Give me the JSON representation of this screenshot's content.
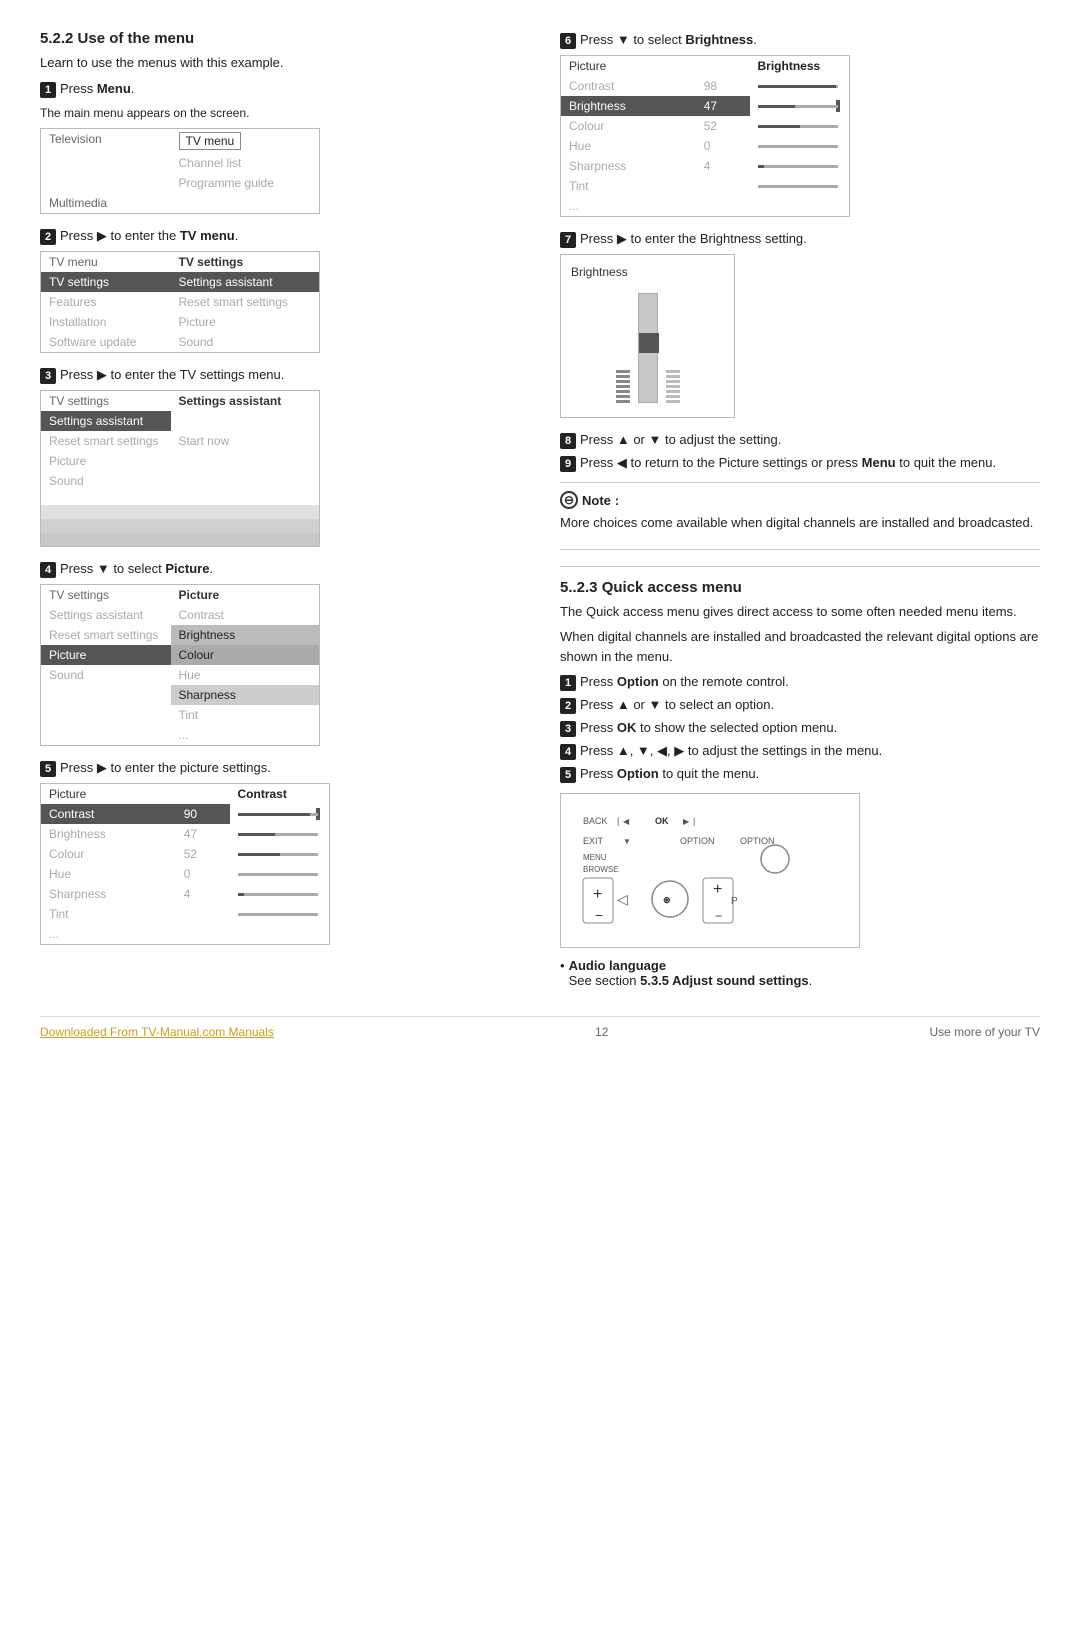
{
  "section": {
    "title": "5.2.2  Use of the menu",
    "intro": "Learn to use the menus with this example."
  },
  "steps_left": [
    {
      "num": "1",
      "text": "Press ",
      "bold": "Menu",
      "suffix": "."
    },
    {
      "num": "2",
      "text": "Press ▶ to enter the ",
      "bold": "TV menu",
      "suffix": "."
    },
    {
      "num": "3",
      "text": "Press ▶ to enter the TV settings menu.",
      "bold": "",
      "suffix": ""
    },
    {
      "num": "4",
      "text": "Press ▼ to select ",
      "bold": "Picture",
      "suffix": "."
    },
    {
      "num": "5",
      "text": "Press ▶ to enter the picture settings.",
      "bold": "",
      "suffix": ""
    }
  ],
  "steps_right": [
    {
      "num": "6",
      "text": "Press ▼ to select ",
      "bold": "Brightness",
      "suffix": "."
    },
    {
      "num": "7",
      "text": "Press ▶ to enter the Brightness setting.",
      "bold": "",
      "suffix": ""
    },
    {
      "num": "8",
      "text": "Press ▲ or ▼ to adjust the setting.",
      "bold": "",
      "suffix": ""
    },
    {
      "num": "9",
      "text": "Press ◀ to return to the Picture settings or press ",
      "bold": "Menu",
      "suffix": " to quit the menu."
    }
  ],
  "menu1": {
    "header_left": "Television",
    "header_right": "",
    "rows": [
      {
        "left": "Television",
        "right": "TV menu",
        "right_highlight": true
      },
      {
        "left": "",
        "right": "Channel list",
        "right_highlight": false
      },
      {
        "left": "",
        "right": "Programme guide",
        "right_highlight": false
      },
      {
        "left": "Multimedia",
        "right": "",
        "right_highlight": false
      }
    ]
  },
  "step1_sub": "The main menu appears on the screen.",
  "menu2_header_left": "TV menu",
  "menu2_header_right": "TV settings",
  "menu2_rows": [
    {
      "left": "TV settings",
      "right": "Settings assistant",
      "left_selected": true,
      "right_highlighted": true
    },
    {
      "left": "Features",
      "right": "Reset smart settings"
    },
    {
      "left": "Installation",
      "right": "Picture"
    },
    {
      "left": "Software update",
      "right": "Sound"
    }
  ],
  "menu3_header_left": "TV settings",
  "menu3_header_right": "Settings assistant",
  "menu3_rows": [
    {
      "left": "Settings assistant",
      "right": "",
      "left_selected": true
    },
    {
      "left": "Reset smart settings",
      "right": "Start now"
    },
    {
      "left": "Picture",
      "right": ""
    },
    {
      "left": "Sound",
      "right": ""
    },
    {
      "left": "",
      "right": ""
    },
    {
      "left": "",
      "right": ""
    },
    {
      "left": "",
      "right": ""
    },
    {
      "left": "",
      "right": ""
    }
  ],
  "menu4_header_left": "TV settings",
  "menu4_header_right": "Picture",
  "menu4_rows": [
    {
      "left": "Settings assistant",
      "right": "Contrast"
    },
    {
      "left": "Reset smart settings",
      "right": "Brightness",
      "right_highlighted": true
    },
    {
      "left": "Picture",
      "right": "Colour",
      "left_selected": true
    },
    {
      "left": "Sound",
      "right": "Hue",
      "right_greyed": true
    },
    {
      "left": "",
      "right": "Sharpness",
      "right_highlighted2": true
    },
    {
      "left": "",
      "right": "Tint"
    },
    {
      "left": "",
      "right": "..."
    }
  ],
  "menu5_header_left": "Picture",
  "menu5_header_right": "Contrast",
  "menu5_rows": [
    {
      "left": "Contrast",
      "right_val": "90",
      "selected": true
    },
    {
      "left": "Brightness",
      "right_val": "47"
    },
    {
      "left": "Colour",
      "right_val": "52"
    },
    {
      "left": "Hue",
      "right_val": "0",
      "greyed": true
    },
    {
      "left": "Sharpness",
      "right_val": "4"
    },
    {
      "left": "Tint",
      "right_val": ""
    },
    {
      "left": "...",
      "right_val": ""
    }
  ],
  "menu6_header_left": "Picture",
  "menu6_header_right": "Brightness",
  "menu6_rows": [
    {
      "left": "Contrast",
      "right_val": "98"
    },
    {
      "left": "Brightness",
      "right_val": "47",
      "selected": true
    },
    {
      "left": "Colour",
      "right_val": "52"
    },
    {
      "left": "Hue",
      "right_val": "0",
      "greyed": true
    },
    {
      "left": "Sharpness",
      "right_val": "4"
    },
    {
      "left": "Tint",
      "right_val": ""
    },
    {
      "left": "...",
      "right_val": ""
    }
  ],
  "big_slider_label": "Brightness",
  "note": {
    "title": "Note",
    "text": "More choices come available when digital channels are installed and broadcasted."
  },
  "section523": {
    "title": "5..2.3  Quick access menu",
    "intro1": "The Quick access menu gives direct access to some often needed menu items.",
    "intro2": "When digital channels are installed and broadcasted the relevant digital options are shown in the menu.",
    "steps": [
      {
        "num": "1",
        "text": "Press ",
        "bold": "Option",
        "suffix": " on the remote control."
      },
      {
        "num": "2",
        "text": "Press ▲ or ▼ to select an option."
      },
      {
        "num": "3",
        "text": "Press ",
        "bold": "OK",
        "suffix": " to show the selected option menu."
      },
      {
        "num": "4",
        "text": "Press ▲, ▼, ◀, ▶ to adjust the settings in the menu."
      },
      {
        "num": "5",
        "text": "Press ",
        "bold": "Option",
        "suffix": " to quit the menu."
      }
    ]
  },
  "bullet_items": [
    {
      "label": "Audio language",
      "sub": "See section ",
      "sub_bold": "5.3.5 Adjust sound settings",
      "sub_suffix": "."
    }
  ],
  "footer": {
    "link_text": "Downloaded From TV-Manual.com Manuals",
    "page_num": "12",
    "right_text": "Use more of your TV"
  }
}
